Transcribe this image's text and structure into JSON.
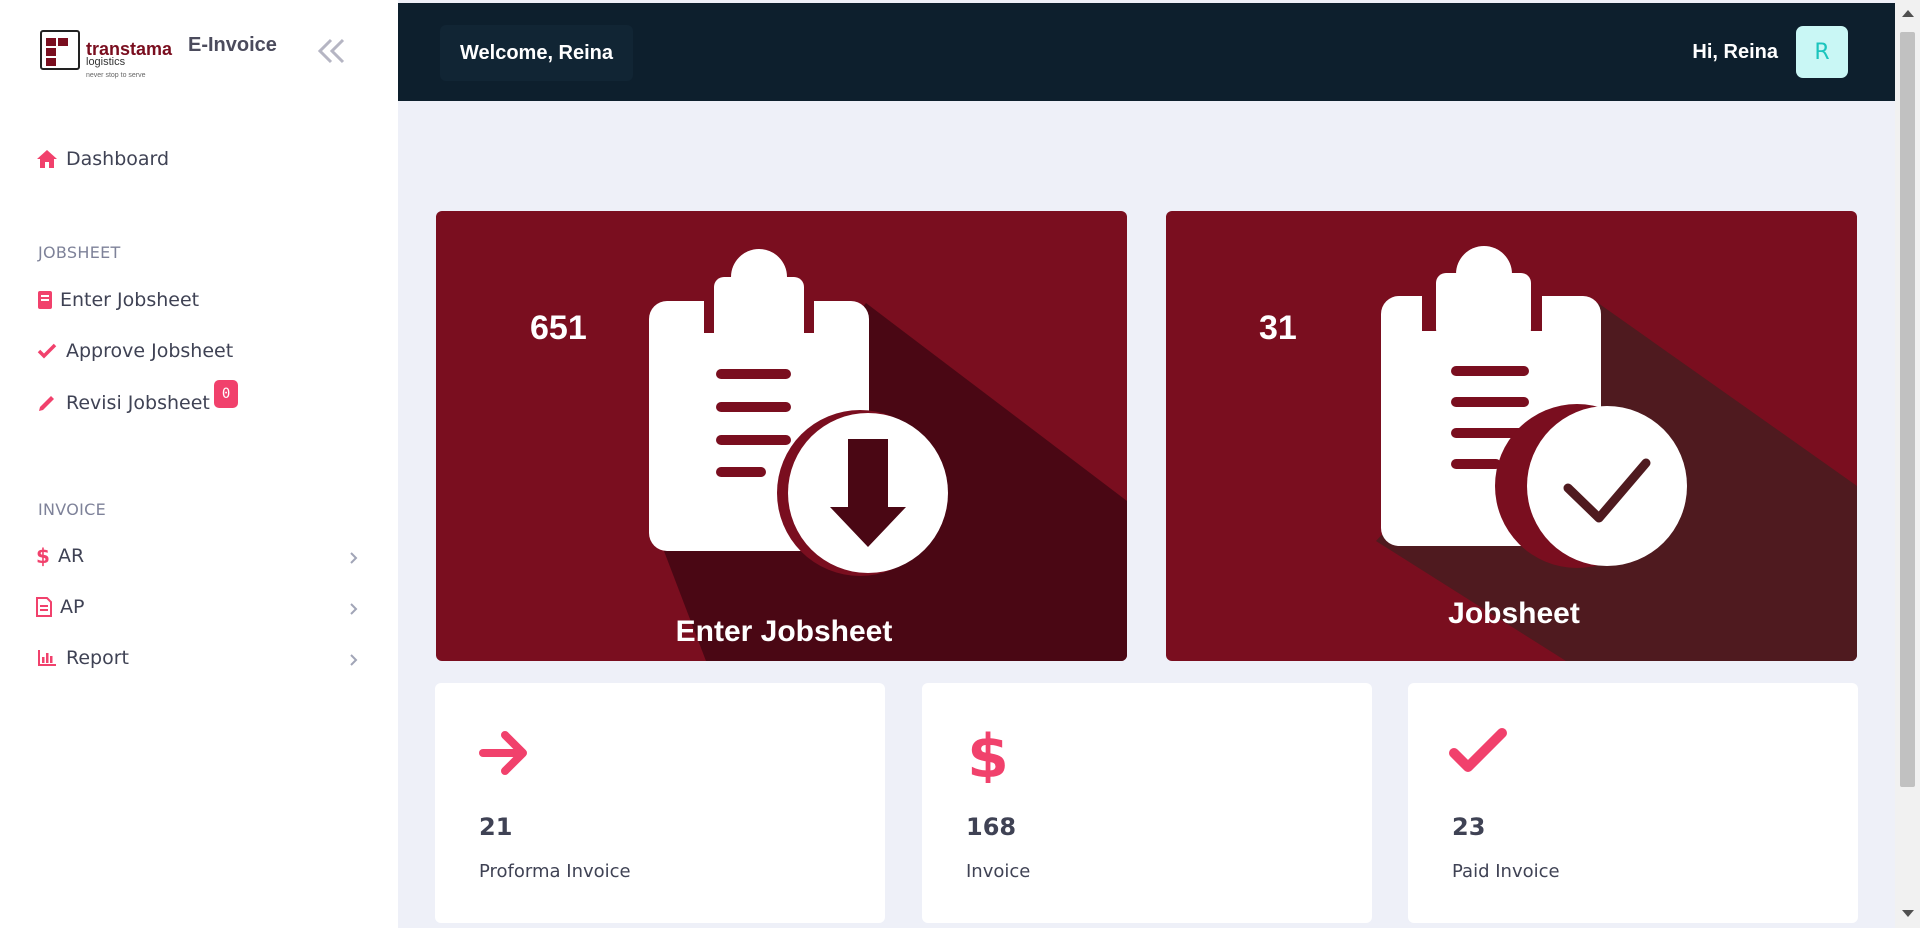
{
  "brand": {
    "logo_name": "transtama",
    "logo_sub": "logistics",
    "logo_tagline": "never stop to serve",
    "app_name": "E-Invoice"
  },
  "sidebar": {
    "dashboard": "Dashboard",
    "jobsheet_section": "JOBSHEET",
    "enter_jobsheet": "Enter Jobsheet",
    "approve_jobsheet": "Approve Jobsheet",
    "revisi_jobsheet": "Revisi Jobsheet",
    "revisi_badge": "0",
    "invoice_section": "INVOICE",
    "ar": "AR",
    "ap": "AP",
    "report": "Report"
  },
  "topbar": {
    "welcome": "Welcome, Reina",
    "greeting": "Hi, Reina",
    "avatar_initial": "R"
  },
  "cards": {
    "enter_jobsheet": {
      "count": "651",
      "title": "Enter Jobsheet",
      "icon": "clipboard-download-icon"
    },
    "jobsheet": {
      "count": "31",
      "title": "Jobsheet",
      "icon": "clipboard-check-icon"
    }
  },
  "stats": [
    {
      "value": "21",
      "label": "Proforma Invoice",
      "icon": "arrow-right-icon"
    },
    {
      "value": "168",
      "label": "Invoice",
      "icon": "dollar-icon"
    },
    {
      "value": "23",
      "label": "Paid Invoice",
      "icon": "check-icon"
    }
  ],
  "colors": {
    "accent": "#f1416c",
    "card_red": "#7a0e1f",
    "topbar": "#0d1f2d",
    "avatar_bg": "#c9f7f5",
    "avatar_text": "#1bc5bd"
  }
}
